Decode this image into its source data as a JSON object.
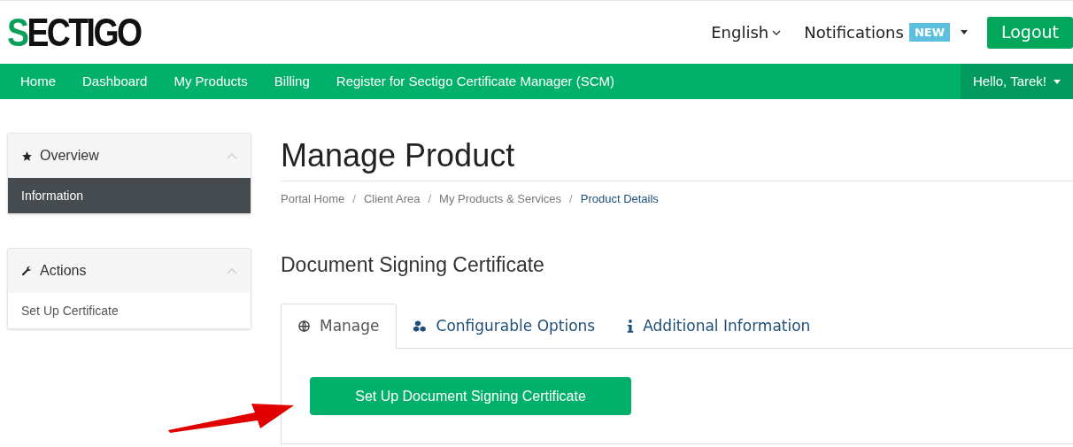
{
  "header": {
    "logo": "SECTIGO",
    "language": "English",
    "notifications": {
      "label": "Notifications",
      "badge": "NEW"
    },
    "logout": "Logout"
  },
  "nav": {
    "items": [
      {
        "label": "Home"
      },
      {
        "label": "Dashboard"
      },
      {
        "label": "My Products"
      },
      {
        "label": "Billing"
      },
      {
        "label": "Register for Sectigo Certificate Manager (SCM)"
      }
    ],
    "user": "Hello, Tarek!"
  },
  "sidebar": {
    "panels": [
      {
        "title": "Overview",
        "expanded": true,
        "items": [
          {
            "label": "Information",
            "selected": true
          }
        ]
      },
      {
        "title": "Actions",
        "expanded": true,
        "items": [
          {
            "label": "Set Up Certificate",
            "selected": false
          }
        ]
      }
    ]
  },
  "page": {
    "title": "Manage Product",
    "breadcrumb_separator": "/",
    "breadcrumb": [
      {
        "label": "Portal Home",
        "current": false
      },
      {
        "label": "Client Area",
        "current": false
      },
      {
        "label": "My Products & Services",
        "current": false
      },
      {
        "label": "Product Details",
        "current": true
      }
    ],
    "product": "Document Signing Certificate",
    "tabs": [
      {
        "label": "Manage",
        "selected": true
      },
      {
        "label": "Configurable Options",
        "selected": false
      },
      {
        "label": "Additional Information",
        "selected": false
      }
    ],
    "action_button": "Set Up Document Signing Certificate"
  }
}
